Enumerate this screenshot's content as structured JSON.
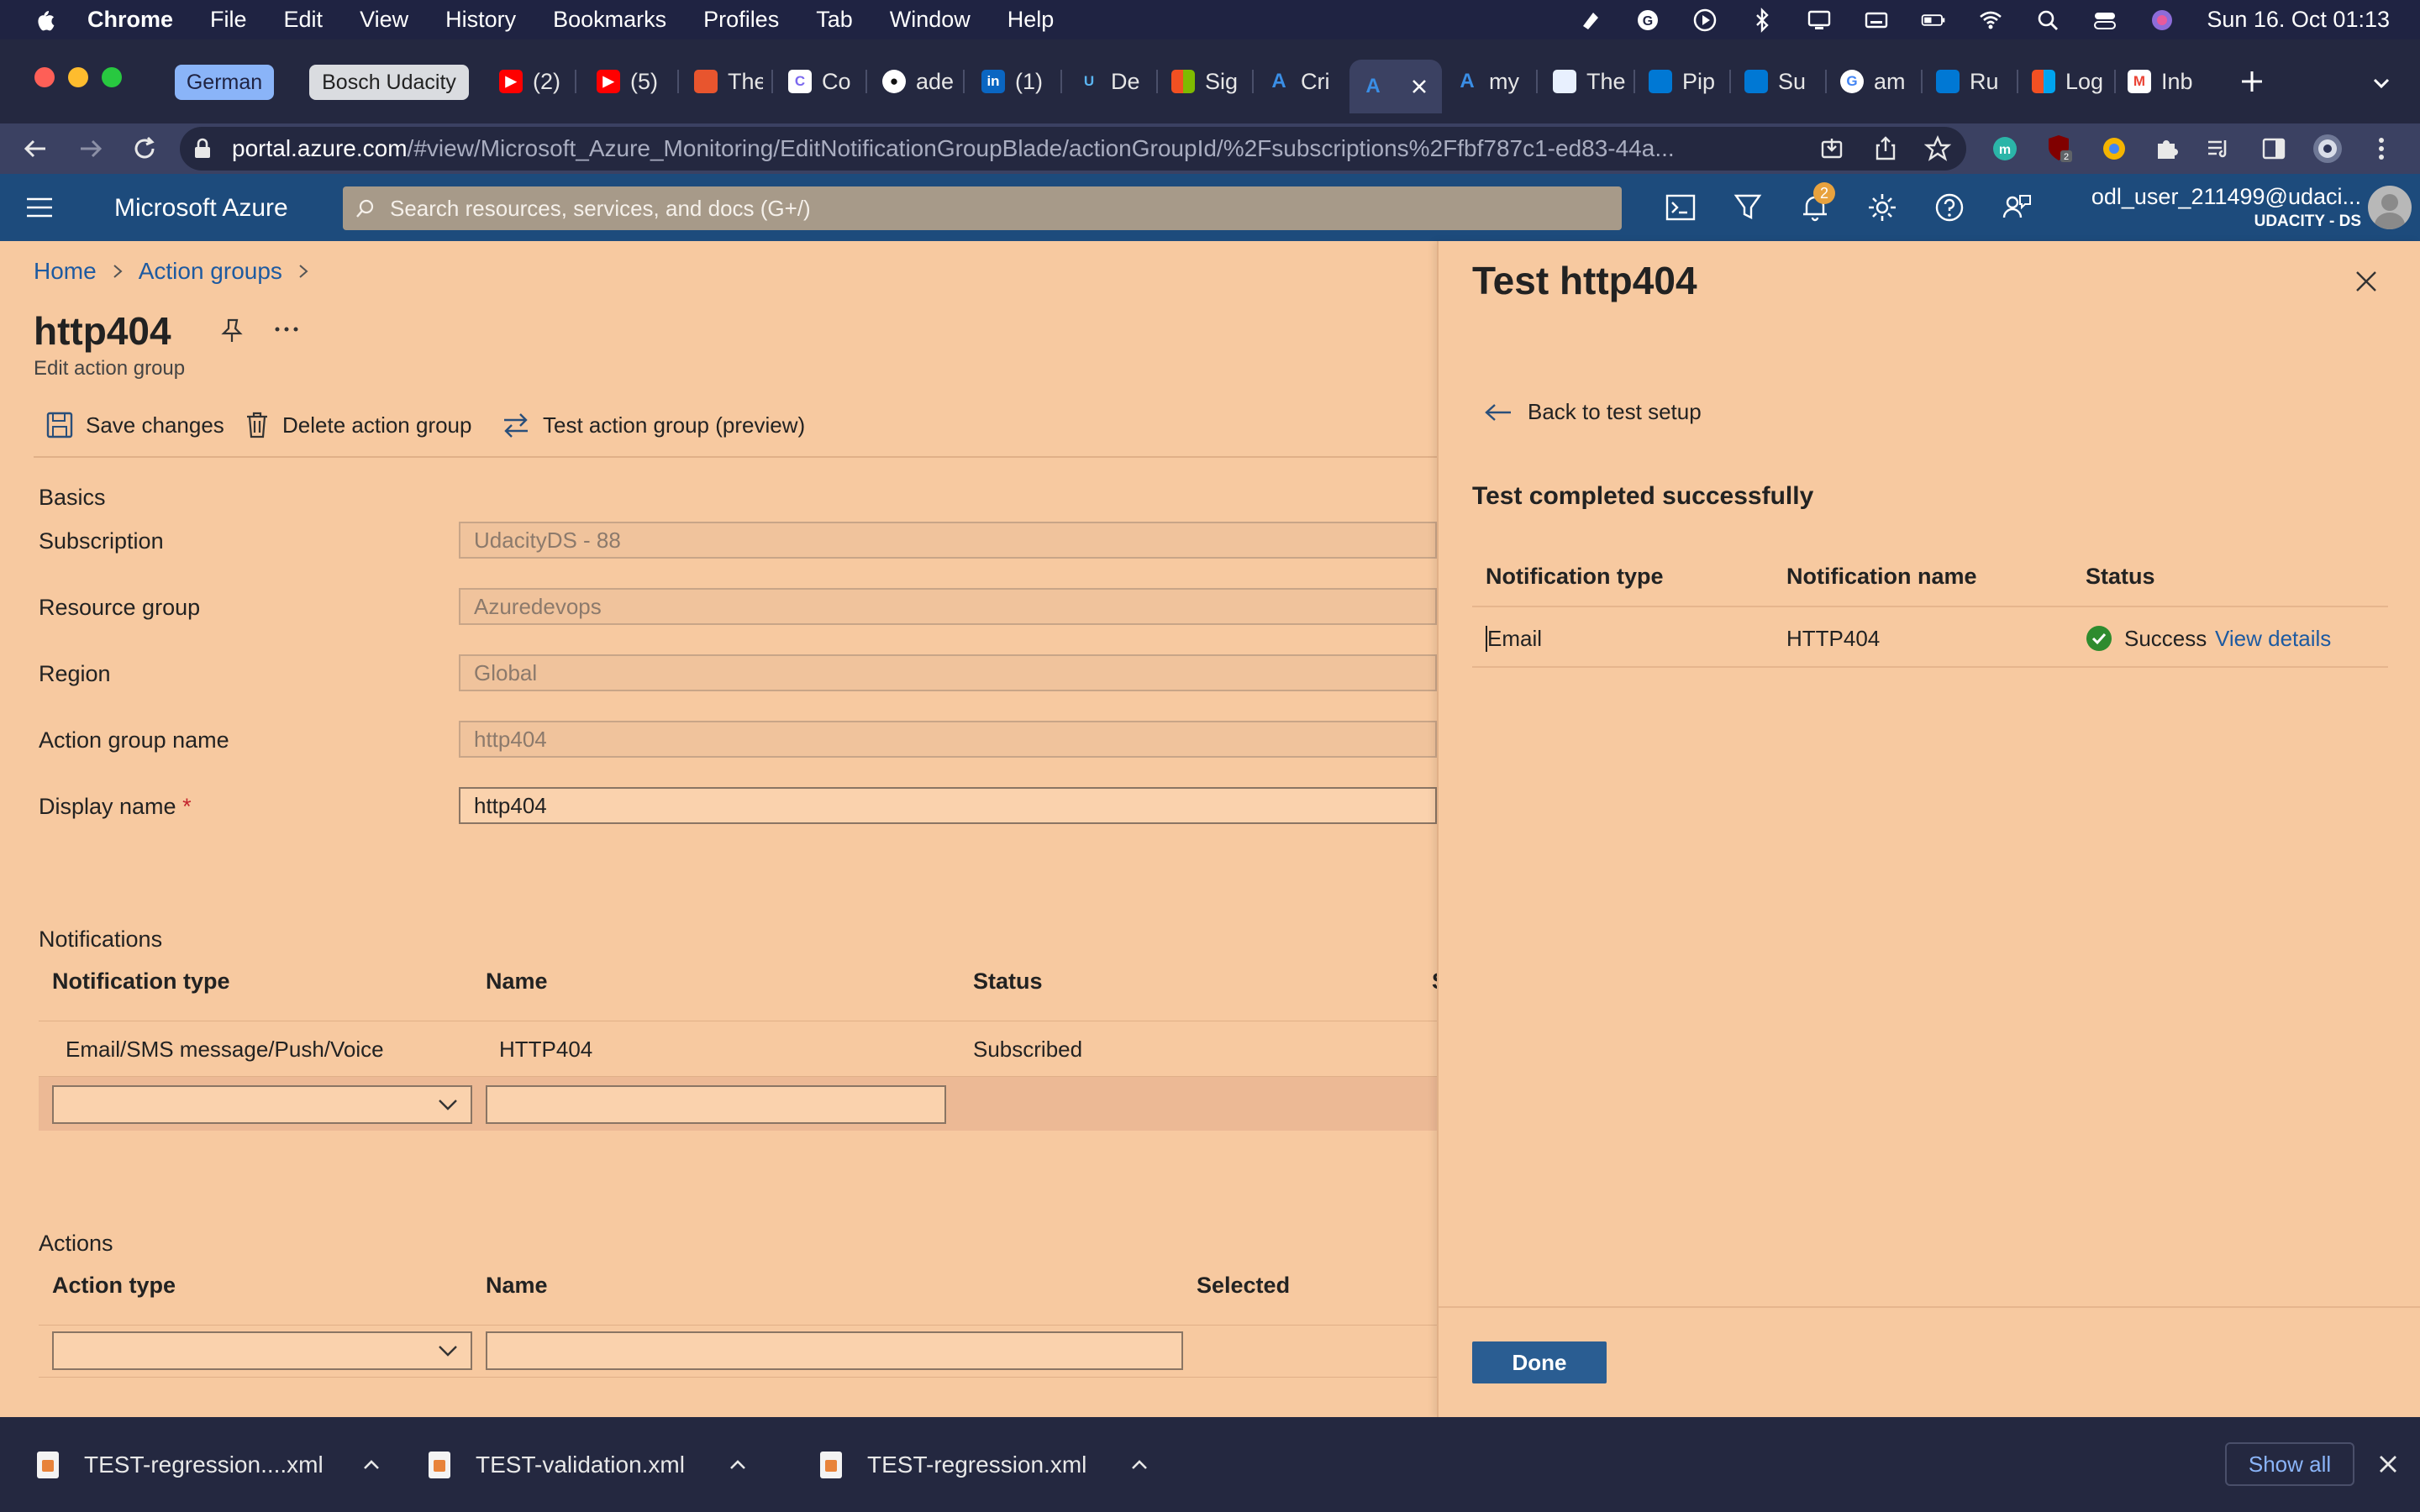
{
  "menubar": {
    "app": "Chrome",
    "items": [
      "File",
      "Edit",
      "View",
      "History",
      "Bookmarks",
      "Profiles",
      "Tab",
      "Window",
      "Help"
    ],
    "datetime": "Sun 16. Oct  01:13"
  },
  "tabs": {
    "groups": [
      "German",
      "Bosch Udacity"
    ],
    "items": [
      {
        "label": "(2)",
        "icon": "youtube-icon"
      },
      {
        "label": "(5)",
        "icon": "youtube-icon"
      },
      {
        "label": "The",
        "icon": "page-icon"
      },
      {
        "label": "Co",
        "icon": "clickup-icon"
      },
      {
        "label": "ade",
        "icon": "github-icon"
      },
      {
        "label": "(1)",
        "icon": "linkedin-icon"
      },
      {
        "label": "De",
        "icon": "udacity-icon"
      },
      {
        "label": "Sig",
        "icon": "microsoft-icon"
      },
      {
        "label": "Cri",
        "icon": "azure-icon"
      },
      {
        "label": "my",
        "icon": "azure-icon"
      },
      {
        "label": "The",
        "icon": "docs-icon"
      },
      {
        "label": "Pip",
        "icon": "azure-devops-icon"
      },
      {
        "label": "Su",
        "icon": "azure-devops-icon"
      },
      {
        "label": "am",
        "icon": "google-icon"
      },
      {
        "label": "Ru",
        "icon": "azure-devops-icon"
      },
      {
        "label": "Log",
        "icon": "microsoft-icon"
      },
      {
        "label": "Inb",
        "icon": "gmail-icon"
      }
    ]
  },
  "address": {
    "domain": "portal.azure.com",
    "path": "/#view/Microsoft_Azure_Monitoring/EditNotificationGroupBlade/actionGroupId/%2Fsubscriptions%2Ffbf787c1-ed83-44a..."
  },
  "azure": {
    "brand": "Microsoft Azure",
    "search_placeholder": "Search resources, services, and docs (G+/)",
    "notification_count": "2",
    "user": "odl_user_211499@udaci...",
    "tenant": "UDACITY - DS"
  },
  "breadcrumb": [
    "Home",
    "Action groups"
  ],
  "page": {
    "title": "http404",
    "subtitle": "Edit action group",
    "commands": {
      "save": "Save changes",
      "delete": "Delete action group",
      "test": "Test action group (preview)"
    }
  },
  "basics": {
    "heading": "Basics",
    "fields": [
      {
        "label": "Subscription",
        "value": "UdacityDS - 88",
        "required": ""
      },
      {
        "label": "Resource group",
        "value": "Azuredevops",
        "required": ""
      },
      {
        "label": "Region",
        "value": "Global",
        "required": ""
      },
      {
        "label": "Action group name",
        "value": "http404",
        "required": ""
      },
      {
        "label": "Display name",
        "value": "http404",
        "required": "*"
      }
    ]
  },
  "notifications": {
    "heading": "Notifications",
    "columns": [
      "Notification type",
      "Name",
      "Status"
    ],
    "rows": [
      {
        "type": "Email/SMS message/Push/Voice",
        "name": "HTTP404",
        "status": "Subscribed"
      }
    ]
  },
  "actions": {
    "heading": "Actions",
    "columns": [
      "Action type",
      "Name",
      "Selected"
    ]
  },
  "panel": {
    "title": "Test http404",
    "back": "Back to test setup",
    "result": "Test completed successfully",
    "columns": [
      "Notification type",
      "Notification name",
      "Status"
    ],
    "rows": [
      {
        "type": "Email",
        "name": "HTTP404",
        "status": "Success",
        "link": "View details"
      }
    ],
    "done": "Done"
  },
  "downloads": {
    "items": [
      "TEST-regression....xml",
      "TEST-validation.xml",
      "TEST-regression.xml"
    ],
    "show_all": "Show all"
  },
  "colors": {
    "page_bg": "#f7c9a0",
    "azure_header": "#1d4b7c",
    "link": "#1d5aa1",
    "primary_button": "#2a5d92",
    "success": "#2e8b2e"
  }
}
